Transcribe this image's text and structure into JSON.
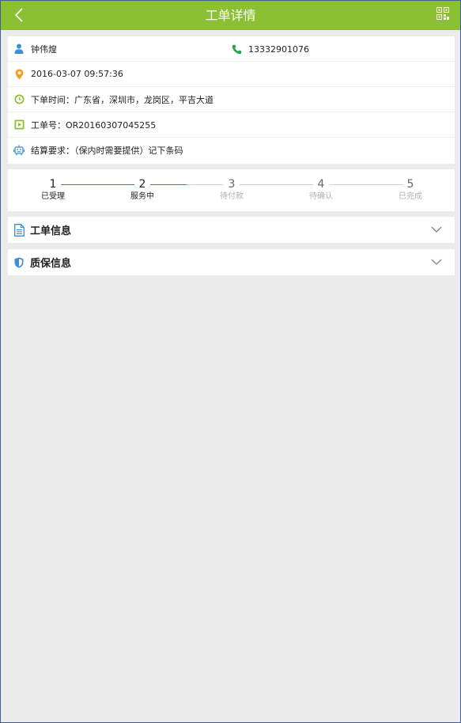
{
  "header": {
    "title": "工单详情",
    "back_icon": "chevron-left-icon",
    "qr_icon": "qr-code-icon",
    "bg_color": "#8bc034"
  },
  "info": {
    "customer_name": "钟伟煌",
    "phone": "13332901076",
    "datetime": "2016-03-07 09:57:36",
    "order_location": "下单时间：广东省，深圳市，龙岗区，平吉大道",
    "order_number": "工单号：OR20160307045255",
    "settlement": "结算要求：（保内时需要提供）记下条码"
  },
  "steps": [
    {
      "num": "1",
      "label": "已受理",
      "state": "done"
    },
    {
      "num": "2",
      "label": "服务中",
      "state": "current"
    },
    {
      "num": "3",
      "label": "待付款",
      "state": "pending"
    },
    {
      "num": "4",
      "label": "待确认",
      "state": "pending"
    },
    {
      "num": "5",
      "label": "已完成",
      "state": "pending"
    }
  ],
  "sections": {
    "order_info": "工单信息",
    "warranty_info": "质保信息"
  },
  "colors": {
    "accent": "#8bc034",
    "progress": "#2f7fc1",
    "user_icon": "#3b8fd6",
    "phone_icon": "#2aa34a",
    "location_icon": "#f0a022"
  }
}
